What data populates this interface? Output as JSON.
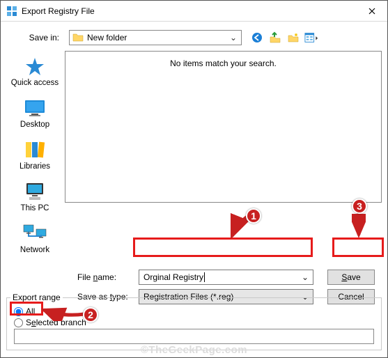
{
  "window": {
    "title": "Export Registry File"
  },
  "savein": {
    "label": "Save in:",
    "value": "New folder"
  },
  "toolbar_icons": [
    "back-icon",
    "up-icon",
    "new-folder-icon",
    "views-icon"
  ],
  "places": [
    {
      "key": "quickaccess",
      "label": "Quick access"
    },
    {
      "key": "desktop",
      "label": "Desktop"
    },
    {
      "key": "libraries",
      "label": "Libraries"
    },
    {
      "key": "thispc",
      "label": "This PC"
    },
    {
      "key": "network",
      "label": "Network"
    }
  ],
  "listing": {
    "empty_message": "No items match your search."
  },
  "filename": {
    "label_pre": "File ",
    "label_ul": "n",
    "label_post": "ame:",
    "value": "Orginal Registry"
  },
  "filetype": {
    "label_pre": "Save as ",
    "label_ul": "t",
    "label_post": "ype:",
    "value": "Registration Files (*.reg)"
  },
  "buttons": {
    "save_ul": "S",
    "save_rest": "ave",
    "cancel": "Cancel"
  },
  "export": {
    "group_label": "Export range",
    "all_ul": "A",
    "all_rest": "ll",
    "selected_pre": "S",
    "selected_ul": "e",
    "selected_post": "lected branch",
    "branch_value": "",
    "selected_option": "all"
  },
  "annotations": {
    "badges": [
      "1",
      "2",
      "3"
    ]
  },
  "watermark": "©TheGeekPage.com"
}
